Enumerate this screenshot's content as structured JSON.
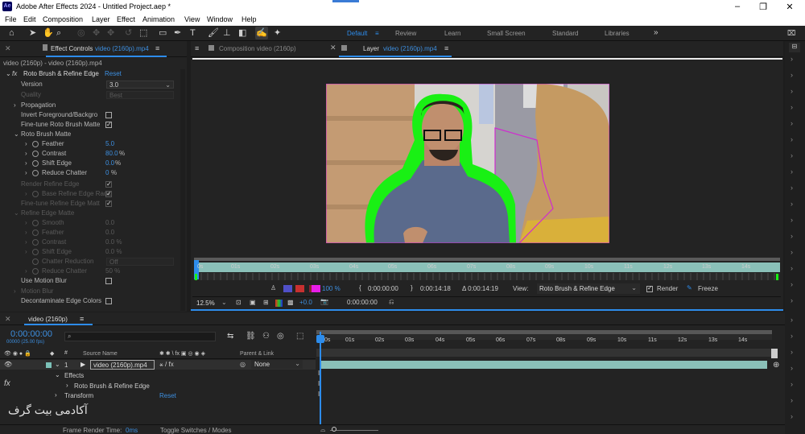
{
  "titlebar": {
    "title": "Adobe After Effects 2024 - Untitled Project.aep *",
    "app_badge": "Ae"
  },
  "menu": [
    "File",
    "Edit",
    "Composition",
    "Layer",
    "Effect",
    "Animation",
    "View",
    "Window",
    "Help"
  ],
  "workspaces": {
    "default": "Default",
    "items": [
      "Review",
      "Learn",
      "Small Screen",
      "Standard",
      "Libraries"
    ],
    "more": "»"
  },
  "effect_controls": {
    "tab_label": "Effect Controls",
    "tab_source": "video (2160p).mp4",
    "breadcrumb": "video (2160p) - video (2160p).mp4",
    "effect_name": "Roto Brush & Refine Edge",
    "reset": "Reset",
    "fx_badge": "fx",
    "version_label": "Version",
    "version_value": "3.0",
    "quality_label": "Quality",
    "quality_value": "Best",
    "propagation": "Propagation",
    "invert_label": "Invert Foreground/Backgro",
    "finetune_label": "Fine-tune Roto Brush Matte",
    "matte_group": "Roto Brush Matte",
    "feather_label": "Feather",
    "feather_value": "5.0",
    "contrast_label": "Contrast",
    "contrast_value": "80.0",
    "contrast_unit": "%",
    "shift_label": "Shift Edge",
    "shift_value": "0.0",
    "shift_unit": "%",
    "chatter_label": "Reduce Chatter",
    "chatter_value": "0",
    "chatter_unit": "%",
    "render_refine": "Render Refine Edge",
    "base_refine": "Base Refine Edge Radiu",
    "finetune_refine": "Fine-tune Refine Edge Matt",
    "refine_matte": "Refine Edge Matte",
    "smooth_label": "Smooth",
    "smooth_value": "0.0",
    "feather2_label": "Feather",
    "feather2_value": "0.0",
    "contrast2_label": "Contrast",
    "contrast2_value": "0.0 %",
    "shift2_label": "Shift Edge",
    "shift2_value": "0.0 %",
    "chatter_reduction_label": "Chatter Reduction",
    "chatter_reduction_value": "Off",
    "reduce_chatter2_label": "Reduce Chatter",
    "reduce_chatter2_value": "50 %",
    "motion_blur_label": "Use Motion Blur",
    "motion_blur2_label": "Motion Blur",
    "decontam_label": "Decontaminate Edge Colors"
  },
  "viewer": {
    "comp_tab": "Composition video (2160p)",
    "layer_tab_prefix": "Layer",
    "layer_tab_source": "video (2160p).mp4",
    "ruler_ticks": [
      "0s",
      "01s",
      "02s",
      "03s",
      "04s",
      "05s",
      "06s",
      "07s",
      "08s",
      "09s",
      "10s",
      "11s",
      "12s",
      "13s",
      "14s"
    ],
    "controls": {
      "opacity": "100 %",
      "in_time": "0:00:00:00",
      "out_time": "0:00:14:18",
      "duration": "Δ 0:00:14:19",
      "view_label": "View:",
      "view_value": "Roto Brush & Refine Edge",
      "render_label": "Render",
      "freeze_label": "Freeze"
    },
    "bottom": {
      "zoom": "12.5%",
      "exposure": "+0.0",
      "timecode": "0:00:00:00"
    }
  },
  "timeline": {
    "tab_label": "video (2160p)",
    "timecode": "0:00:00:00",
    "frame_info": "00000 (25.00 fps)",
    "search_placeholder": "",
    "col_source": "Source Name",
    "col_parent": "Parent & Link",
    "layer_num": "1",
    "layer_name": "video (2160p).mp4",
    "parent_value": "None",
    "effects_label": "Effects",
    "roto_label": "Roto Brush & Refine Edge",
    "transform_label": "Transform",
    "reset": "Reset",
    "ruler_ticks": [
      "0s",
      "01s",
      "02s",
      "03s",
      "04s",
      "05s",
      "06s",
      "07s",
      "08s",
      "09s",
      "10s",
      "11s",
      "12s",
      "13s",
      "14s"
    ],
    "render_time_label": "Frame Render Time:",
    "render_time_value": "0ms",
    "toggle_label": "Toggle Switches / Modes",
    "watermark": "آکادمی بیت گرف"
  },
  "colors": {
    "accent": "#2d8ceb",
    "matte_green": "#19f014",
    "track": "#8ac0b8",
    "pink": "#d02bd0"
  }
}
